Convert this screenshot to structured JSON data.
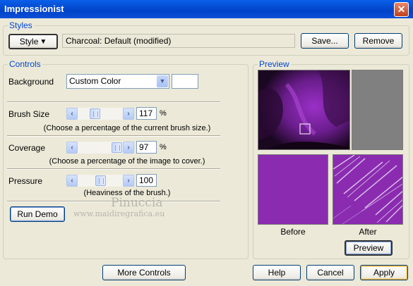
{
  "window": {
    "title": "Impressionist",
    "close_glyph": "✕"
  },
  "styles": {
    "legend": "Styles",
    "style_button": "Style",
    "style_arrow": "▼",
    "current_style": "Charcoal: Default (modified)",
    "save_label": "Save...",
    "remove_label": "Remove"
  },
  "controls": {
    "legend": "Controls",
    "background": {
      "label": "Background",
      "value": "Custom Color",
      "arrow": "▼",
      "swatch_color": "#ffffff"
    },
    "brush_size": {
      "label": "Brush Size",
      "value": "117",
      "unit": "%",
      "hint": "(Choose a percentage of the current brush size.)",
      "slider_fraction": 0.35
    },
    "coverage": {
      "label": "Coverage",
      "value": "97",
      "unit": "%",
      "hint": "(Choose a percentage of the image to cover.)",
      "slider_fraction": 0.97
    },
    "pressure": {
      "label": "Pressure",
      "value": "100",
      "unit": "",
      "hint": "(Heaviness of the brush.)",
      "slider_fraction": 0.5
    },
    "left_arrow": "‹",
    "right_arrow": "›",
    "run_demo_label": "Run Demo"
  },
  "watermark": {
    "name": "Pinuccia",
    "url": "www.maidiregrafica.eu"
  },
  "preview": {
    "legend": "Preview",
    "before_label": "Before",
    "after_label": "After",
    "preview_button": "Preview",
    "colors": {
      "purple": "#8a2bb0",
      "dark": "#1a0720",
      "gray": "#808080"
    }
  },
  "footer": {
    "more_controls": "More Controls",
    "help": "Help",
    "cancel": "Cancel",
    "apply": "Apply"
  }
}
